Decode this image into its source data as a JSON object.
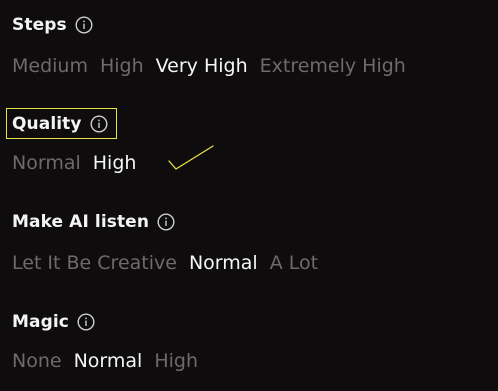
{
  "accent_annotation_color": "#e8e24a",
  "selected_color": "#f6f6f6",
  "unselected_color": "#6d6a6b",
  "sections": [
    {
      "title": "Steps",
      "icon": "info-icon",
      "options": [
        "Medium",
        "High",
        "Very High",
        "Extremely High"
      ],
      "selected": "Very High"
    },
    {
      "title": "Quality",
      "icon": "info-icon",
      "options": [
        "Normal",
        "High"
      ],
      "selected": "High"
    },
    {
      "title": "Make AI listen",
      "icon": "info-icon",
      "options": [
        "Let It Be Creative",
        "Normal",
        "A Lot"
      ],
      "selected": "Normal"
    },
    {
      "title": "Magic",
      "icon": "info-icon",
      "options": [
        "None",
        "Normal",
        "High"
      ],
      "selected": "Normal"
    }
  ]
}
